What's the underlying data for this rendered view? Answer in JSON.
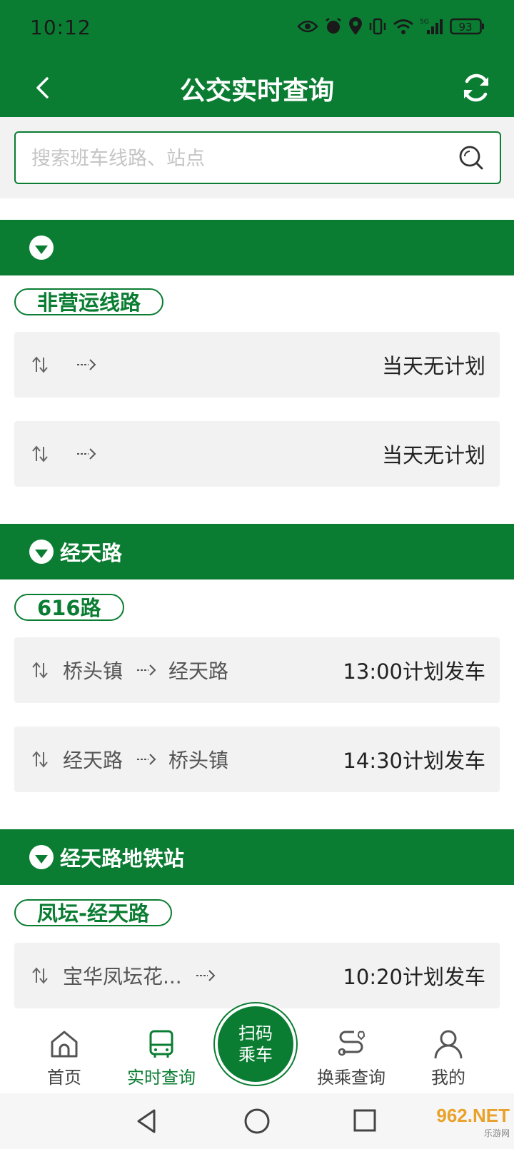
{
  "status_bar": {
    "time": "10:12",
    "battery": "93",
    "network": "5G"
  },
  "title_bar": {
    "title": "公交实时查询"
  },
  "search": {
    "placeholder": "搜索班车线路、站点"
  },
  "sections": [
    {
      "name": "",
      "route_tag": "非营运线路",
      "trips": [
        {
          "from": "",
          "to": "",
          "status": "当天无计划"
        },
        {
          "from": "",
          "to": "",
          "status": "当天无计划"
        }
      ]
    },
    {
      "name": "经天路",
      "route_tag": "616路",
      "trips": [
        {
          "from": "桥头镇",
          "to": "经天路",
          "status": "13:00计划发车"
        },
        {
          "from": "经天路",
          "to": "桥头镇",
          "status": "14:30计划发车"
        }
      ]
    },
    {
      "name": "经天路地铁站",
      "route_tag": "凤坛-经天路",
      "trips": [
        {
          "from": "宝华凤坛花...",
          "to": "",
          "status": "10:20计划发车"
        }
      ]
    }
  ],
  "bottom_nav": {
    "home": "首页",
    "realtime": "实时查询",
    "scan_line1": "扫码",
    "scan_line2": "乘车",
    "transfer": "换乘查询",
    "mine": "我的"
  },
  "watermark": {
    "brand": "962.NET",
    "sub": "乐游网"
  },
  "colors": {
    "primary": "#0a7d32",
    "row_bg": "#f2f2f2"
  }
}
